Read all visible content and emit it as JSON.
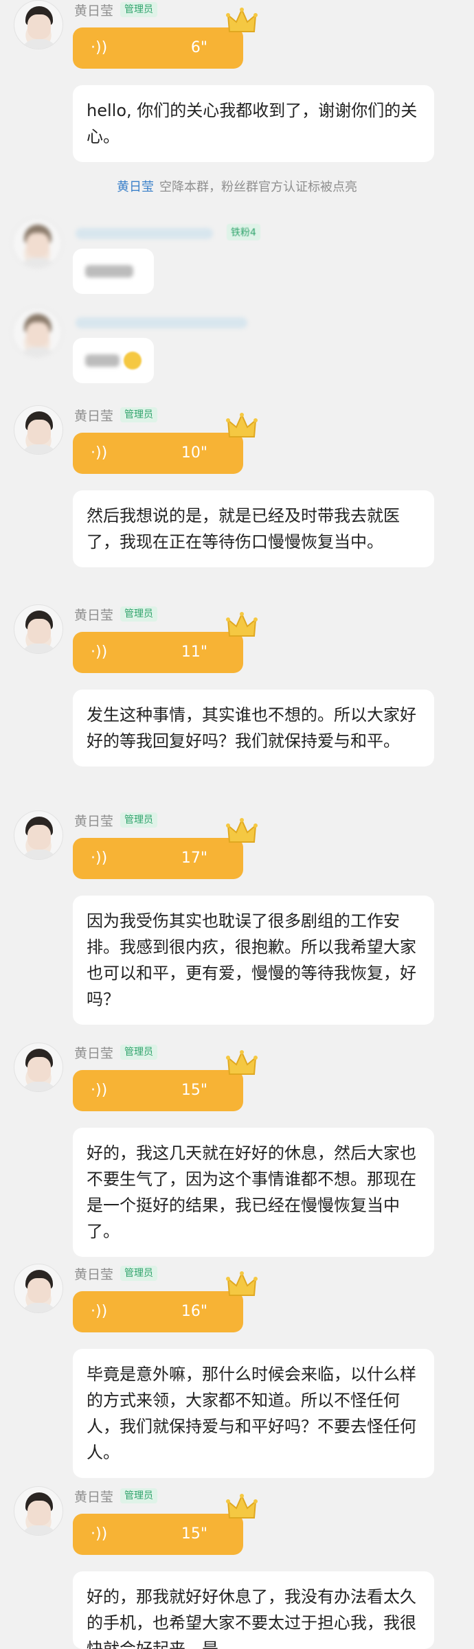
{
  "chat": {
    "admin_name": "黄日莹",
    "admin_badge": "管理员",
    "voice_icon": "sound-wave-icon",
    "crown_icon": "crown-icon",
    "system_notice": {
      "name": "黄日莹",
      "text": "空降本群，粉丝群官方认证标被点亮"
    },
    "fan_badge": "铁粉4",
    "messages": [
      {
        "voice": "6\"",
        "text": "hello, 你们的关心我都收到了，谢谢你们的关心。"
      },
      {
        "voice": "10\"",
        "text": "然后我想说的是，就是已经及时带我去就医了，我现在正在等待伤口慢慢恢复当中。"
      },
      {
        "voice": "11\"",
        "text": "发生这种事情，其实谁也不想的。所以大家好好的等我回复好吗？我们就保持爱与和平。"
      },
      {
        "voice": "17\"",
        "text": "因为我受伤其实也耽误了很多剧组的工作安排。我感到很内疚，很抱歉。所以我希望大家也可以和平，更有爱，慢慢的等待我恢复，好吗？"
      },
      {
        "voice": "15\"",
        "text": "好的，我这几天就在好好的休息，然后大家也不要生气了，因为这个事情谁都不想。那现在是一个挺好的结果，我已经在慢慢恢复当中了。"
      },
      {
        "voice": "16\"",
        "text": "毕竟是意外嘛，那什么时候会来临，以什么样的方式来领，大家都不知道。所以不怪任何人，我们就保持爱与和平好吗？不要去怪任何人。"
      },
      {
        "voice": "15\"",
        "text": "好的，那我就好好休息了，我没有办法看太久的手机，也希望大家不要太过于担心我，我很快就会好起来，是"
      }
    ]
  }
}
